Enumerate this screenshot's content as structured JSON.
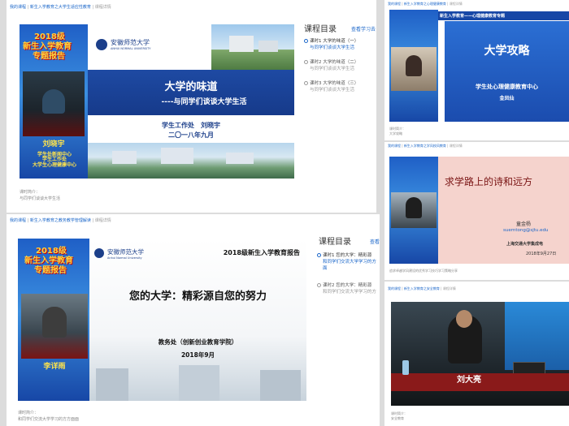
{
  "p1": {
    "crumb": [
      "我的课程",
      "新生入学教育之大学生适应性教育",
      "课程详情"
    ],
    "poster_year": "2018级",
    "poster_sub1": "新生入学教育",
    "poster_sub2": "专题报告",
    "name_card": "刘晓宇",
    "poster_orgs": [
      "学生处新闻中心",
      "学生工作处",
      "大学生心理健康中心"
    ],
    "school_cn": "安徽师范大学",
    "school_en": "ANHUI NORMAL UNIVERSITY",
    "slide_title": "大学的味道",
    "slide_sub": "----与同学们谈谈大学生活",
    "slide_dept": "学生工作处　刘晓宇",
    "slide_date": "二〇一八年九月",
    "list_title": "课程目录",
    "list_link": "查看学习去",
    "lessons": [
      {
        "t": "课时1 大学的味道（一）",
        "s": "与同学们谈谈大学生活"
      },
      {
        "t": "课时2 大学的味道（二）",
        "s": "与同学们谈谈大学生活"
      },
      {
        "t": "课时3 大学的味道（三）",
        "s": "与同学们谈谈大学生活"
      }
    ],
    "intro_label": "课时简介：",
    "intro_text": "与同学们谈谈大学生活"
  },
  "p2": {
    "crumb": [
      "我的课程",
      "新生入学教育之教务教学管理解读",
      "课程详情"
    ],
    "poster_year": "2018级",
    "poster_sub1": "新生入学教育",
    "poster_sub2": "专题报告",
    "name_card": "李详雨",
    "school_cn": "安徽师范大学",
    "school_en": "Anhui Normal University",
    "slide_header": "2018级新生入学教育报告",
    "slide_title": "您的大学：精彩源自您的努力",
    "slide_dept": "教务处（创新创业教育学院）",
    "slide_date": "2018年9月",
    "list_title": "课程目录",
    "list_link": "查看",
    "lessons": [
      {
        "t": "课时1 您的大学：精彩源",
        "s": "和同学们交流大学学习的方"
      },
      {
        "t": "课时2 您的大学：精彩源",
        "s": "和同学们交流大学学习的方"
      }
    ],
    "lesson1_extra": "面",
    "intro_label": "课时简介：",
    "intro_text": "和同学们交流大学学习的方方面面"
  },
  "p3": {
    "crumb": [
      "我的课程",
      "新生入学教育之心理健康教育",
      "课程详情"
    ],
    "slide_title": "大学攻略",
    "slide_dept": "学生处心理健康教育中心",
    "slide_name": "金凤仙",
    "banner": "新生入学教育——心理健康教育专题",
    "intro_label": "课时简介：",
    "intro_text": "大学攻略"
  },
  "p4": {
    "crumb": [
      "我的课程",
      "新生入学教育之学风校风教育",
      "课程详情"
    ],
    "slide_title": "求学路上的诗和远方",
    "slide_speaker": "童金杨",
    "slide_email": "suerntong@sjtu.edu",
    "slide_school": "上海交通大学集成电",
    "slide_date": "2018年9月27日",
    "intro_text": "追求卓越学风建设的优秀学习技巧学习策略分享"
  },
  "p5": {
    "crumb": [
      "我的课程",
      "新生入学教育之安全教育",
      "课程详情"
    ],
    "name_card": "刘大亮",
    "intro_label": "课时简介：",
    "intro_text": "安全教育"
  }
}
